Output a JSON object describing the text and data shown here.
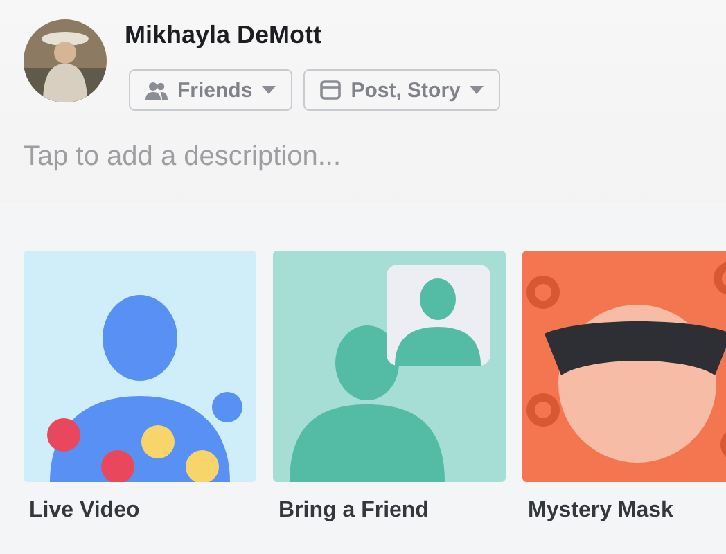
{
  "profile": {
    "name": "Mikhayla DeMott"
  },
  "audience_buttons": [
    {
      "label": "Friends",
      "kind": "people"
    },
    {
      "label": "Post, Story",
      "kind": "window"
    }
  ],
  "description": {
    "placeholder": "Tap to add a description..."
  },
  "effects": [
    {
      "label": "Live Video",
      "kind": "live"
    },
    {
      "label": "Bring a Friend",
      "kind": "friend"
    },
    {
      "label": "Mystery Mask",
      "kind": "mask"
    }
  ]
}
